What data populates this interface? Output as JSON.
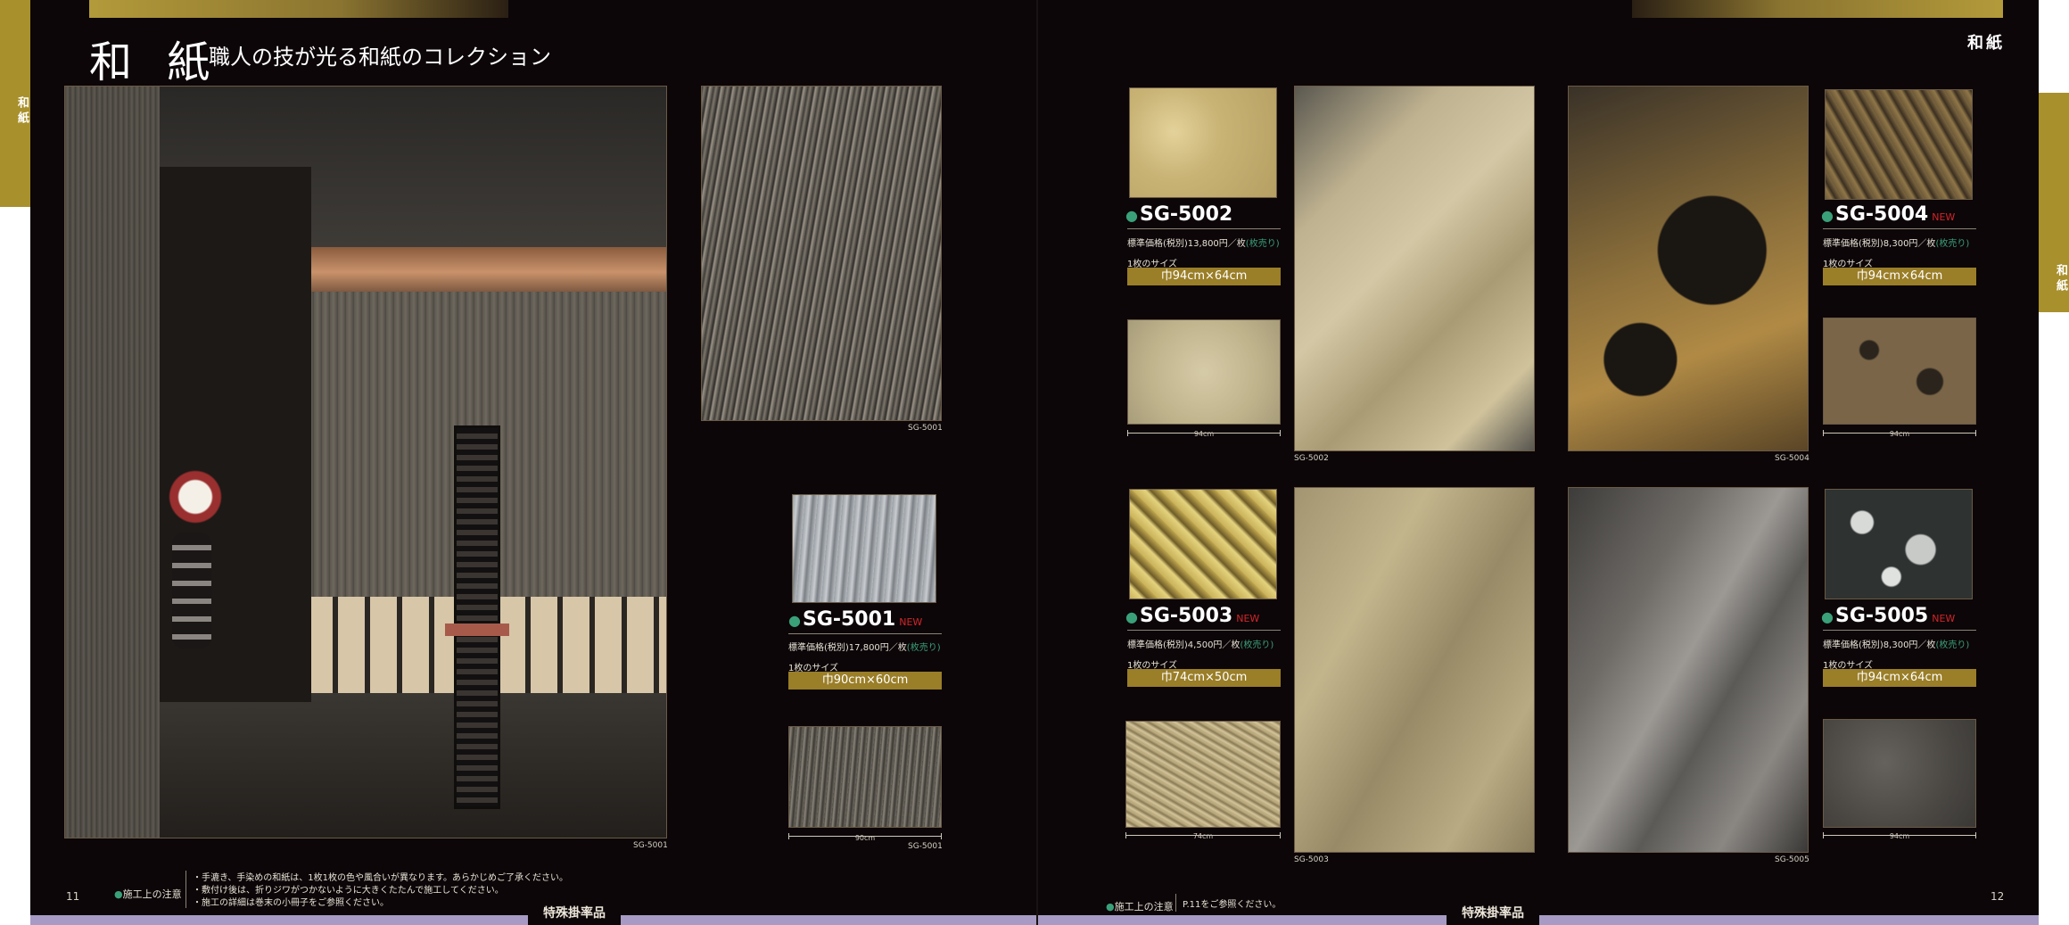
{
  "left_page": {
    "side_tab": "和紙",
    "title": "和 紙",
    "subtitle": "職人の技が光る和紙のコレクション",
    "main_photo_caption": "SG-5001",
    "swatch_caption": "SG-5001",
    "swatch_bottom_caption": "SG-5001",
    "product": {
      "code": "SG-5001",
      "new_badge": "NEW",
      "price_prefix": "標準価格(税別)17,800円／枚",
      "price_suffix": "(枚売り)",
      "size_label": "1枚のサイズ",
      "size_value": "巾90cm×60cm",
      "dimension": "90cm"
    },
    "page_number": "11",
    "caution_label": "施工上の注意",
    "notes": [
      "・手漉き、手染めの和紙は、1枚1枚の色や風合いが異なります。あらかじめご了承ください。",
      "・敷付け後は、折りジワがつかないように大きくたたんで施工してください。",
      "・施工の詳細は巻末の小冊子をご参照ください。"
    ],
    "footer_tag": "特殊掛率品"
  },
  "right_page": {
    "title": "和紙",
    "side_tab": "和紙",
    "products": [
      {
        "code": "SG-5002",
        "new_badge": "",
        "price_prefix": "標準価格(税別)13,800円／枚",
        "price_suffix": "(枚売り)",
        "size_label": "1枚のサイズ",
        "size_value": "巾94cm×64cm",
        "dimension": "94cm",
        "photo_caption": "SG-5002"
      },
      {
        "code": "SG-5004",
        "new_badge": "NEW",
        "price_prefix": "標準価格(税別)8,300円／枚",
        "price_suffix": "(枚売り)",
        "size_label": "1枚のサイズ",
        "size_value": "巾94cm×64cm",
        "dimension": "94cm",
        "photo_caption": "SG-5004"
      },
      {
        "code": "SG-5003",
        "new_badge": "NEW",
        "price_prefix": "標準価格(税別)4,500円／枚",
        "price_suffix": "(枚売り)",
        "size_label": "1枚のサイズ",
        "size_value": "巾74cm×50cm",
        "dimension": "74cm",
        "photo_caption": "SG-5003"
      },
      {
        "code": "SG-5005",
        "new_badge": "NEW",
        "price_prefix": "標準価格(税別)8,300円／枚",
        "price_suffix": "(枚売り)",
        "size_label": "1枚のサイズ",
        "size_value": "巾94cm×64cm",
        "dimension": "94cm",
        "photo_caption": "SG-5005"
      }
    ],
    "page_number": "12",
    "caution_label": "施工上の注意",
    "caution_note": "P.11をご参照ください。",
    "footer_tag": "特殊掛率品"
  },
  "colors": {
    "background": "#0c0608",
    "gold": "#a8902c",
    "size_box": "#9a7e28",
    "new_badge": "#d2252a",
    "green_accent": "#3aa07a",
    "footer_band": "#a79ac4"
  }
}
